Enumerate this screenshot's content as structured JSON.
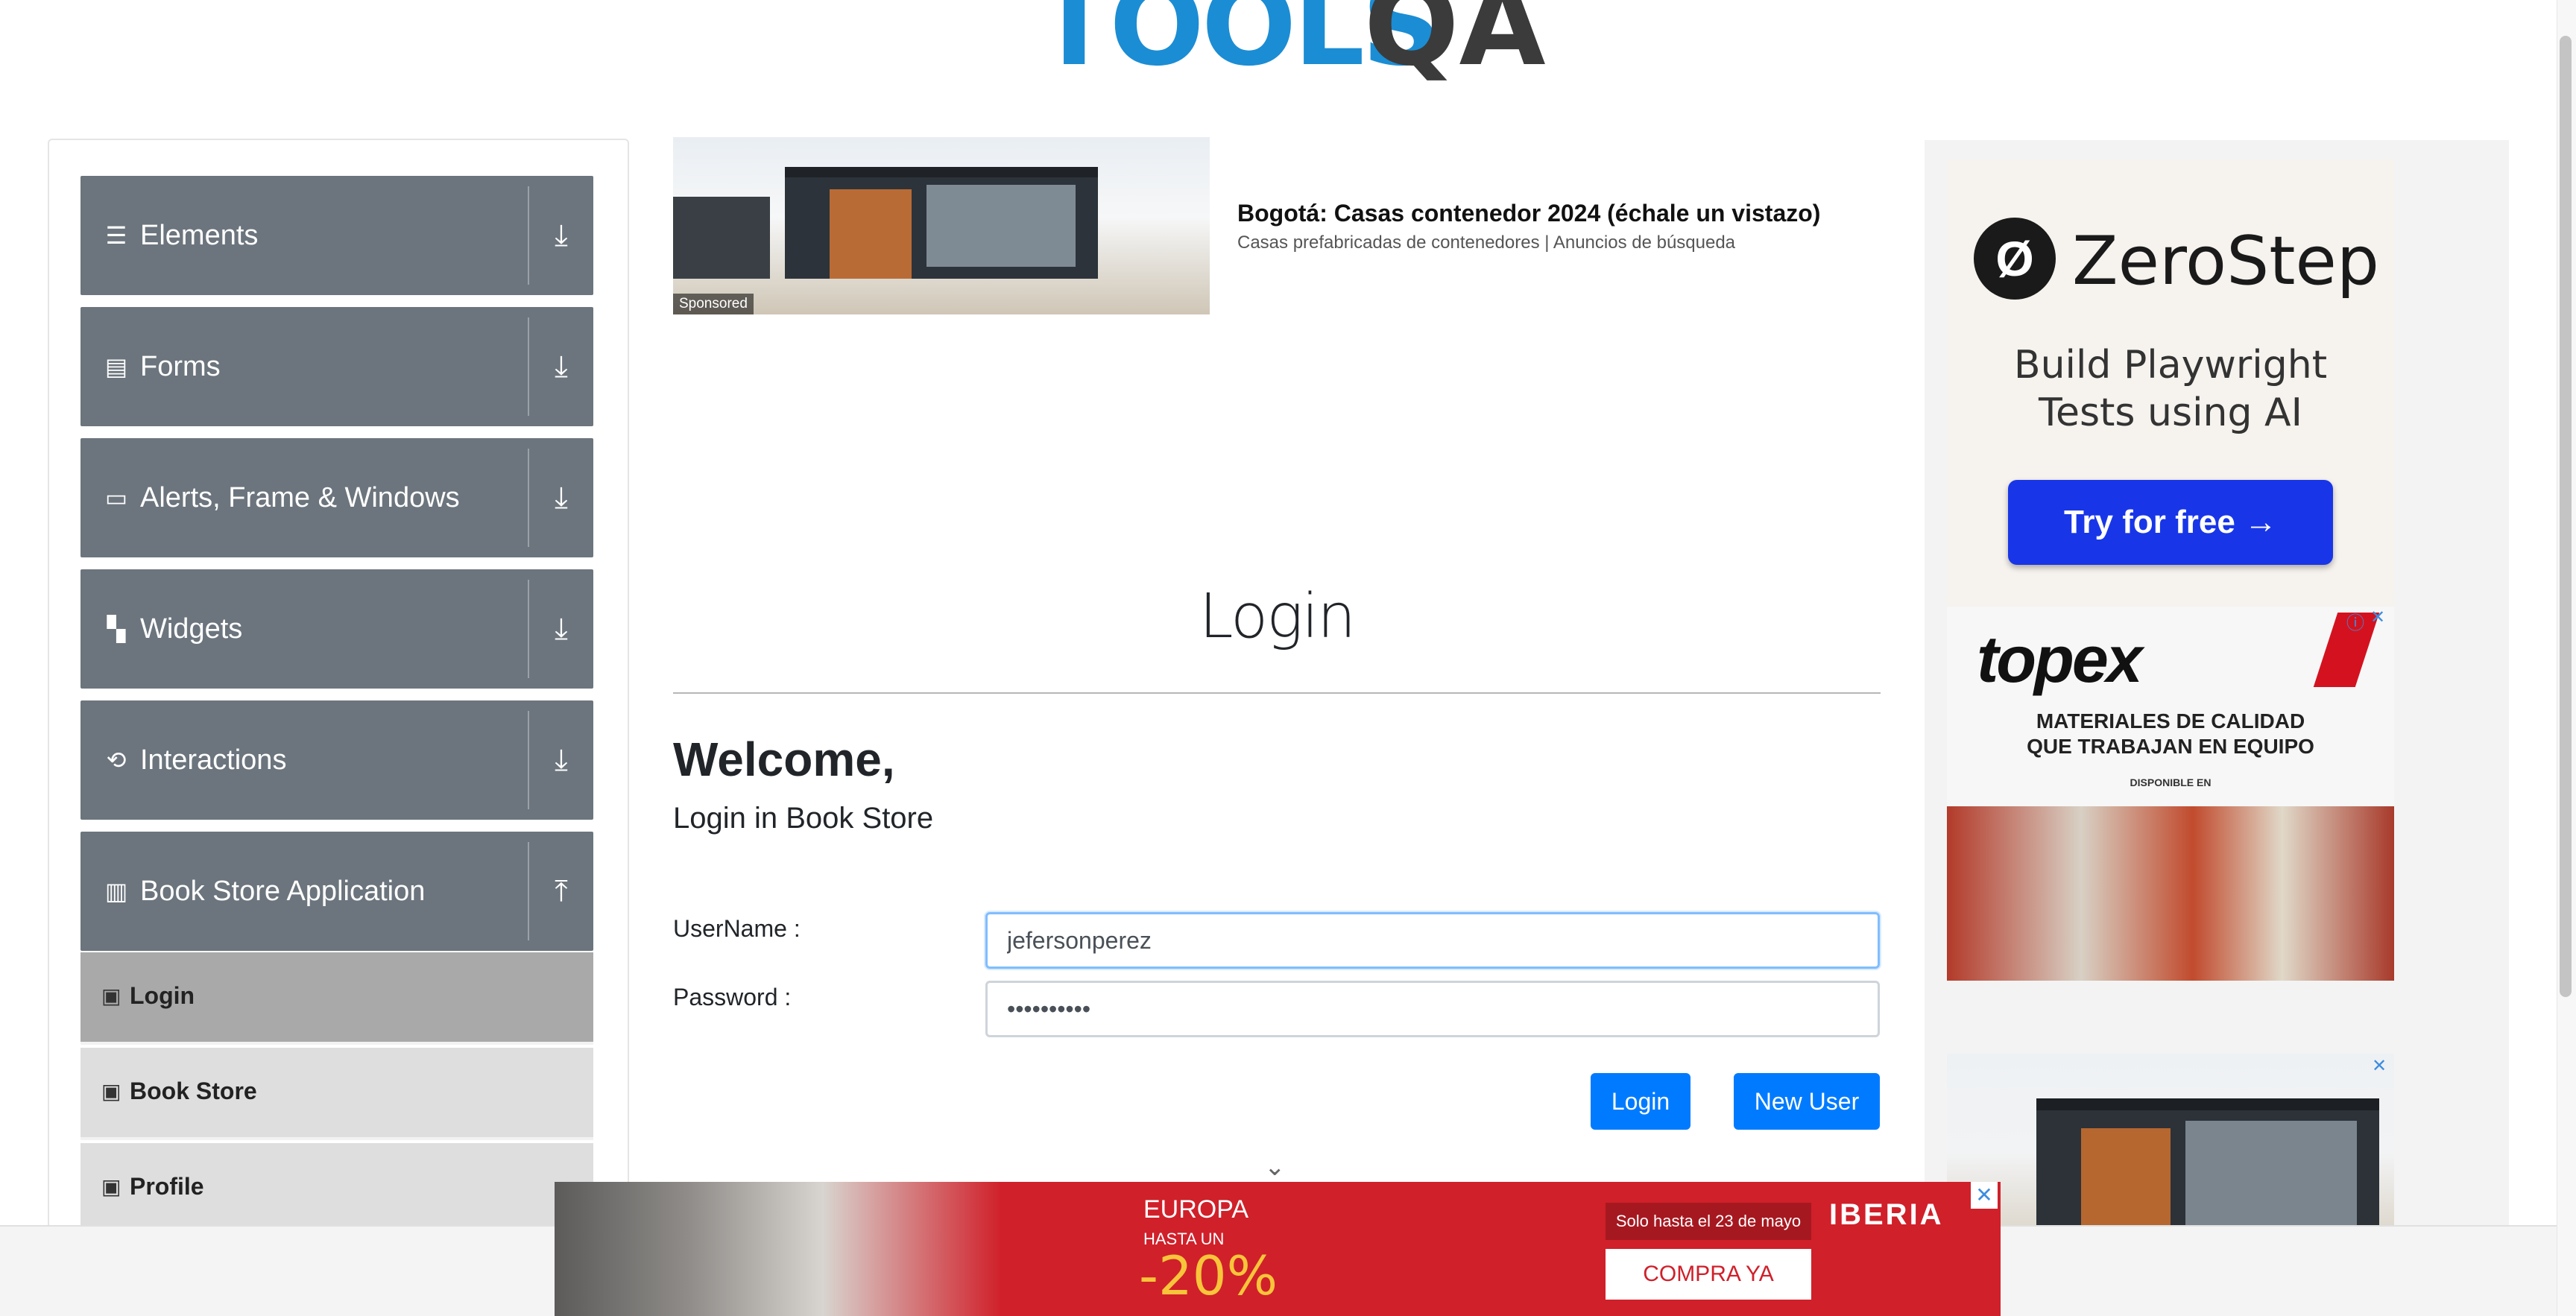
{
  "header": {
    "logo_left": "TOOLS",
    "logo_right": "QA"
  },
  "sidebar": {
    "groups": [
      {
        "label": "Elements",
        "icon": "hamburger-icon",
        "arrow": "download-arrow-icon"
      },
      {
        "label": "Forms",
        "icon": "form-icon",
        "arrow": "download-arrow-icon"
      },
      {
        "label": "Alerts, Frame & Windows",
        "icon": "window-icon",
        "arrow": "download-arrow-icon"
      },
      {
        "label": "Widgets",
        "icon": "widgets-icon",
        "arrow": "download-arrow-icon"
      },
      {
        "label": "Interactions",
        "icon": "interactions-icon",
        "arrow": "download-arrow-icon"
      },
      {
        "label": "Book Store Application",
        "icon": "library-icon",
        "arrow": "upload-arrow-icon"
      }
    ],
    "subitems": [
      {
        "label": "Login",
        "active": true
      },
      {
        "label": "Book Store",
        "active": false
      },
      {
        "label": "Profile",
        "active": false
      }
    ]
  },
  "ad_top": {
    "sponsored": "Sponsored",
    "title": "Bogotá: Casas contenedor 2024 (échale un vistazo)",
    "subtitle": "Casas prefabricadas de contenedores | Anuncios de búsqueda"
  },
  "main": {
    "page_title": "Login",
    "welcome": "Welcome,",
    "subheading": "Login in Book Store",
    "username_label": "UserName :",
    "username_value": "jefersonperez",
    "password_label": "Password :",
    "password_value": "••••••••••",
    "login_button": "Login",
    "new_user_button": "New User"
  },
  "right_ads": {
    "zerostep": {
      "name": "ZeroStep",
      "line1": "Build Playwright",
      "line2": "Tests using AI",
      "cta": "Try for free →"
    },
    "topex": {
      "logo": "topex",
      "line1": "MATERIALES DE CALIDAD",
      "line2": "QUE TRABAJAN EN EQUIPO",
      "small": "DISPONIBLE EN"
    }
  },
  "bottom_ad": {
    "destination": "EUROPA",
    "hasta": "HASTA UN",
    "discount": "-20%",
    "date": "Solo hasta el 23 de mayo",
    "cta": "COMPRA YA",
    "brand": "IBERIA"
  },
  "colors": {
    "sidebar_group": "#6c757d",
    "primary_button": "#007bff",
    "logo_blue": "#1b8dd4",
    "iberia_red": "#d0202a"
  }
}
